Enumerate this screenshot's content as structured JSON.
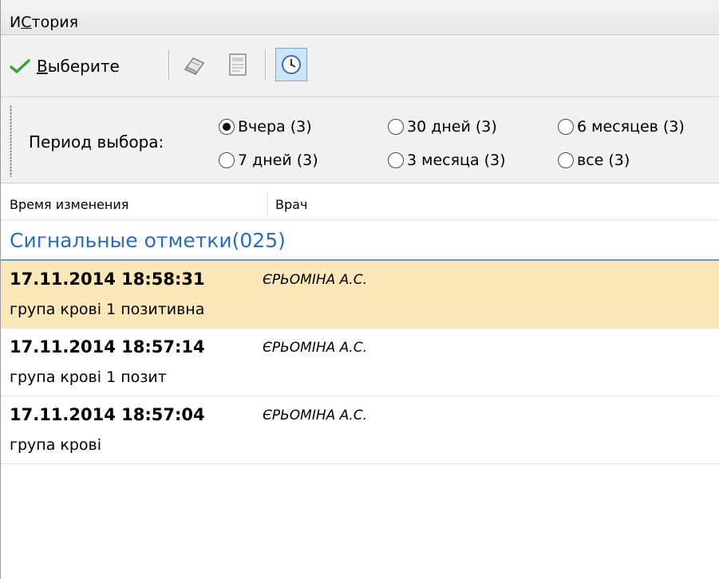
{
  "window": {
    "title_underlined": "С",
    "title_pre": "И",
    "title_post": "тория"
  },
  "toolbar": {
    "select_underlined": "В",
    "select_rest": "ыберите",
    "icons": [
      "checkmark-icon",
      "eraser-icon",
      "document-icon",
      "clock-icon"
    ]
  },
  "period": {
    "label": "Период выбора:",
    "options": [
      {
        "label": "Вчера (3)",
        "checked": true
      },
      {
        "label": "30 дней (3)",
        "checked": false
      },
      {
        "label": "6 месяцев (3)",
        "checked": false
      },
      {
        "label": "7 дней (3)",
        "checked": false
      },
      {
        "label": "3 месяца (3)",
        "checked": false
      },
      {
        "label": "все (3)",
        "checked": false
      }
    ]
  },
  "table": {
    "columns": [
      "Время изменения",
      "Врач"
    ],
    "group": "Сигнальные отметки(025)",
    "records": [
      {
        "datetime": "17.11.2014 18:58:31",
        "doctor": "ЄРЬОМІНА А.С.",
        "text": "група крові 1 позитивна",
        "selected": true
      },
      {
        "datetime": "17.11.2014 18:57:14",
        "doctor": "ЄРЬОМІНА А.С.",
        "text": "група крові 1 позит",
        "selected": false
      },
      {
        "datetime": "17.11.2014 18:57:04",
        "doctor": "ЄРЬОМІНА А.С.",
        "text": "група крові",
        "selected": false
      }
    ]
  },
  "colors": {
    "selected_row": "#fbe7b8",
    "group_title": "#2c6db5",
    "checkmark": "#3aa33a"
  }
}
